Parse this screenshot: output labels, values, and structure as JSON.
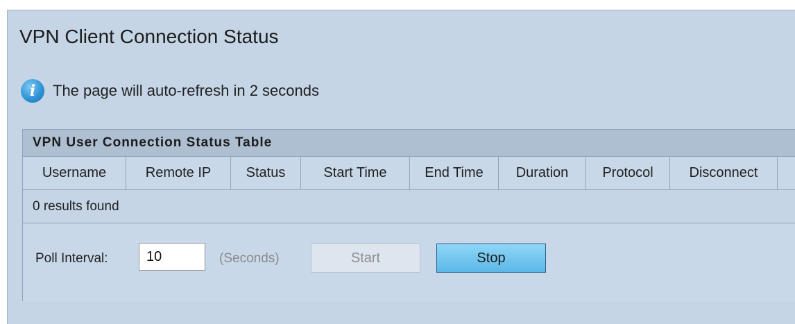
{
  "page": {
    "title": "VPN Client Connection Status",
    "info_message": "The page will auto-refresh in 2 seconds"
  },
  "table": {
    "caption": "VPN User Connection Status Table",
    "columns": [
      "Username",
      "Remote IP",
      "Status",
      "Start Time",
      "End Time",
      "Duration",
      "Protocol",
      "Disconnect"
    ],
    "results_text": "0 results found"
  },
  "controls": {
    "poll_label": "Poll Interval:",
    "poll_value": "10",
    "units": "(Seconds)",
    "start_label": "Start",
    "stop_label": "Stop"
  },
  "icons": {
    "info": "info-icon"
  },
  "colors": {
    "background": "#c5d5e6",
    "caption_bg": "#aebfd2",
    "stop_button": "#5cb8e8"
  }
}
